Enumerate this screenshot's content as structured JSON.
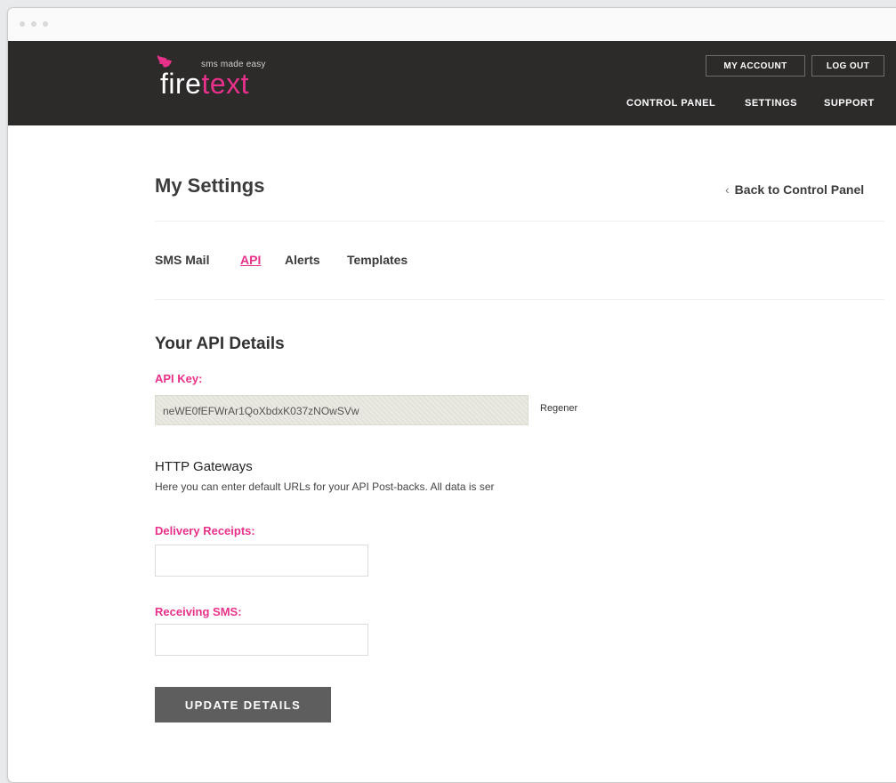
{
  "brand": {
    "tagline": "sms made easy",
    "name_part1": "fire",
    "name_part2": "text",
    "accent_color": "#e8318a",
    "header_bg": "#2d2b2a"
  },
  "header": {
    "account_button": "MY ACCOUNT",
    "logout_button": "LOG OUT",
    "nav": [
      "CONTROL PANEL",
      "SETTINGS",
      "SUPPORT"
    ]
  },
  "page": {
    "title": "My Settings",
    "back_link": "Back to Control Panel",
    "back_icon": "chevron-left-icon",
    "tabs": [
      {
        "label": "SMS Mail",
        "active": false
      },
      {
        "label": "API",
        "active": true
      },
      {
        "label": "Alerts",
        "active": false
      },
      {
        "label": "Templates",
        "active": false
      }
    ]
  },
  "api": {
    "section_title": "Your API Details",
    "key_label": "API Key:",
    "key_value": "neWE0fEFWrAr1QoXbdxK037zNOwSVw",
    "regenerate_label": "Regener"
  },
  "gateways": {
    "title": "HTTP Gateways",
    "description": "Here you can enter default URLs for your API Post-backs. All data is ser",
    "delivery_label": "Delivery Receipts:",
    "delivery_value": "",
    "receiving_label": "Receiving SMS:",
    "receiving_value": ""
  },
  "actions": {
    "update_button": "UPDATE DETAILS"
  }
}
